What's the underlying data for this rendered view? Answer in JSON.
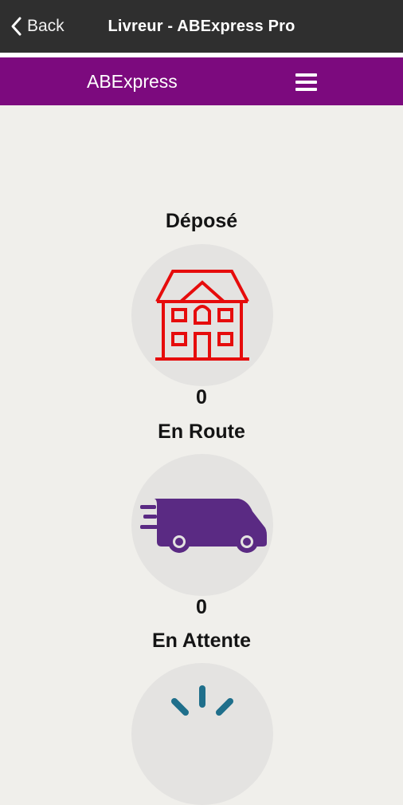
{
  "header": {
    "back_label": "Back",
    "title": "Livreur - ABExpress Pro"
  },
  "appbar": {
    "brand": "ABExpress",
    "menu_icon": "hamburger-menu-icon"
  },
  "statuses": [
    {
      "label": "Déposé",
      "count": "0",
      "icon": "house-icon",
      "color": "#e60c0c"
    },
    {
      "label": "En Route",
      "count": "0",
      "icon": "delivery-van-icon",
      "color": "#5a2a83"
    },
    {
      "label": "En Attente",
      "count": "",
      "icon": "loading-spinner-icon",
      "color": "#1f6f8b"
    }
  ]
}
